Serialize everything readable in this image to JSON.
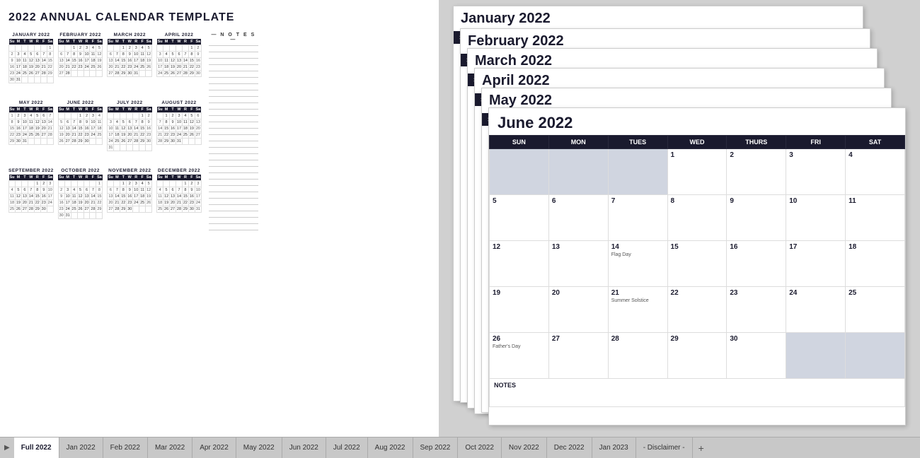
{
  "title": "2022 ANNUAL CALENDAR TEMPLATE",
  "colors": {
    "header_dark": "#1a1a2e",
    "shaded_cell": "#d0d5e0",
    "empty_cell": "#e8eaf0"
  },
  "mini_months": [
    {
      "name": "JANUARY 2022",
      "days_header": [
        "Su",
        "M",
        "T",
        "W",
        "R",
        "F",
        "Sa"
      ],
      "weeks": [
        [
          "",
          "",
          "",
          "",
          "",
          "",
          "1"
        ],
        [
          "2",
          "3",
          "4",
          "5",
          "6",
          "7",
          "8"
        ],
        [
          "9",
          "10",
          "11",
          "12",
          "13",
          "14",
          "15"
        ],
        [
          "16",
          "17",
          "18",
          "19",
          "20",
          "21",
          "22"
        ],
        [
          "23",
          "24",
          "25",
          "26",
          "27",
          "28",
          "29"
        ],
        [
          "30",
          "31",
          "",
          "",
          "",
          "",
          ""
        ]
      ]
    },
    {
      "name": "FEBRUARY 2022",
      "days_header": [
        "Su",
        "M",
        "T",
        "W",
        "R",
        "F",
        "Sa"
      ],
      "weeks": [
        [
          "",
          "",
          "1",
          "2",
          "3",
          "4",
          "5"
        ],
        [
          "6",
          "7",
          "8",
          "9",
          "10",
          "11",
          "12"
        ],
        [
          "13",
          "14",
          "15",
          "16",
          "17",
          "18",
          "19"
        ],
        [
          "20",
          "21",
          "22",
          "23",
          "24",
          "25",
          "26"
        ],
        [
          "27",
          "28",
          "",
          "",
          "",
          "",
          ""
        ]
      ]
    },
    {
      "name": "MARCH 2022",
      "days_header": [
        "Su",
        "M",
        "T",
        "W",
        "R",
        "F",
        "Sa"
      ],
      "weeks": [
        [
          "",
          "",
          "1",
          "2",
          "3",
          "4",
          "5"
        ],
        [
          "6",
          "7",
          "8",
          "9",
          "10",
          "11",
          "12"
        ],
        [
          "13",
          "14",
          "15",
          "16",
          "17",
          "18",
          "19"
        ],
        [
          "20",
          "21",
          "22",
          "23",
          "24",
          "25",
          "26"
        ],
        [
          "27",
          "28",
          "29",
          "30",
          "31",
          "",
          ""
        ]
      ]
    },
    {
      "name": "APRIL 2022",
      "days_header": [
        "Su",
        "M",
        "T",
        "W",
        "R",
        "F",
        "Sa"
      ],
      "weeks": [
        [
          "",
          "",
          "",
          "",
          "",
          "1",
          "2"
        ],
        [
          "3",
          "4",
          "5",
          "6",
          "7",
          "8",
          "9"
        ],
        [
          "10",
          "11",
          "12",
          "13",
          "14",
          "15",
          "16"
        ],
        [
          "17",
          "18",
          "19",
          "20",
          "21",
          "22",
          "23"
        ],
        [
          "24",
          "25",
          "26",
          "27",
          "28",
          "29",
          "30"
        ]
      ]
    },
    {
      "name": "MAY 2022",
      "days_header": [
        "Su",
        "M",
        "T",
        "W",
        "R",
        "F",
        "Sa"
      ],
      "weeks": [
        [
          "1",
          "2",
          "3",
          "4",
          "5",
          "6",
          "7"
        ],
        [
          "8",
          "9",
          "10",
          "11",
          "12",
          "13",
          "14"
        ],
        [
          "15",
          "16",
          "17",
          "18",
          "19",
          "20",
          "21"
        ],
        [
          "22",
          "23",
          "24",
          "25",
          "26",
          "27",
          "28"
        ],
        [
          "29",
          "30",
          "31",
          "",
          "",
          "",
          ""
        ]
      ]
    },
    {
      "name": "JUNE 2022",
      "days_header": [
        "Su",
        "M",
        "T",
        "W",
        "R",
        "F",
        "Sa"
      ],
      "weeks": [
        [
          "",
          "",
          "",
          "1",
          "2",
          "3",
          "4"
        ],
        [
          "5",
          "6",
          "7",
          "8",
          "9",
          "10",
          "11"
        ],
        [
          "12",
          "13",
          "14",
          "15",
          "16",
          "17",
          "18"
        ],
        [
          "19",
          "20",
          "21",
          "22",
          "23",
          "24",
          "25"
        ],
        [
          "26",
          "27",
          "28",
          "29",
          "30",
          "",
          ""
        ]
      ]
    },
    {
      "name": "JULY 2022",
      "days_header": [
        "Su",
        "M",
        "T",
        "W",
        "R",
        "F",
        "Sa"
      ],
      "weeks": [
        [
          "",
          "",
          "",
          "",
          "",
          "1",
          "2"
        ],
        [
          "3",
          "4",
          "5",
          "6",
          "7",
          "8",
          "9"
        ],
        [
          "10",
          "11",
          "12",
          "13",
          "14",
          "15",
          "16"
        ],
        [
          "17",
          "18",
          "19",
          "20",
          "21",
          "22",
          "23"
        ],
        [
          "24",
          "25",
          "26",
          "27",
          "28",
          "29",
          "30"
        ],
        [
          "31",
          "",
          "",
          "",
          "",
          "",
          ""
        ]
      ]
    },
    {
      "name": "AUGUST 2022",
      "days_header": [
        "Su",
        "M",
        "T",
        "W",
        "R",
        "F",
        "Sa"
      ],
      "weeks": [
        [
          "",
          "1",
          "2",
          "3",
          "4",
          "5",
          "6"
        ],
        [
          "7",
          "8",
          "9",
          "10",
          "11",
          "12",
          "13"
        ],
        [
          "14",
          "15",
          "16",
          "17",
          "18",
          "19",
          "20"
        ],
        [
          "21",
          "22",
          "23",
          "24",
          "25",
          "26",
          "27"
        ],
        [
          "28",
          "29",
          "30",
          "31",
          "",
          "",
          ""
        ]
      ]
    },
    {
      "name": "SEPTEMBER 2022",
      "days_header": [
        "Su",
        "M",
        "T",
        "W",
        "R",
        "F",
        "Sa"
      ],
      "weeks": [
        [
          "",
          "",
          "",
          "",
          "1",
          "2",
          "3"
        ],
        [
          "4",
          "5",
          "6",
          "7",
          "8",
          "9",
          "10"
        ],
        [
          "11",
          "12",
          "13",
          "14",
          "15",
          "16",
          "17"
        ],
        [
          "18",
          "19",
          "20",
          "21",
          "22",
          "23",
          "24"
        ],
        [
          "25",
          "26",
          "27",
          "28",
          "29",
          "30",
          ""
        ]
      ]
    },
    {
      "name": "OCTOBER 2022",
      "days_header": [
        "Su",
        "M",
        "T",
        "W",
        "R",
        "F",
        "Sa"
      ],
      "weeks": [
        [
          "",
          "",
          "",
          "",
          "",
          "",
          "1"
        ],
        [
          "2",
          "3",
          "4",
          "5",
          "6",
          "7",
          "8"
        ],
        [
          "9",
          "10",
          "11",
          "12",
          "13",
          "14",
          "15"
        ],
        [
          "16",
          "17",
          "18",
          "19",
          "20",
          "21",
          "22"
        ],
        [
          "23",
          "24",
          "25",
          "26",
          "27",
          "28",
          "29"
        ],
        [
          "30",
          "31",
          "",
          "",
          "",
          "",
          ""
        ]
      ]
    },
    {
      "name": "NOVEMBER 2022",
      "days_header": [
        "Su",
        "M",
        "T",
        "W",
        "R",
        "F",
        "Sa"
      ],
      "weeks": [
        [
          "",
          "",
          "1",
          "2",
          "3",
          "4",
          "5"
        ],
        [
          "6",
          "7",
          "8",
          "9",
          "10",
          "11",
          "12"
        ],
        [
          "13",
          "14",
          "15",
          "16",
          "17",
          "18",
          "19"
        ],
        [
          "20",
          "21",
          "22",
          "23",
          "24",
          "25",
          "26"
        ],
        [
          "27",
          "28",
          "29",
          "30",
          "",
          "",
          ""
        ]
      ]
    },
    {
      "name": "DECEMBER 2022",
      "days_header": [
        "Su",
        "M",
        "T",
        "W",
        "R",
        "F",
        "Sa"
      ],
      "weeks": [
        [
          "",
          "",
          "",
          "",
          "1",
          "2",
          "3"
        ],
        [
          "4",
          "5",
          "6",
          "7",
          "8",
          "9",
          "10"
        ],
        [
          "11",
          "12",
          "13",
          "14",
          "15",
          "16",
          "17"
        ],
        [
          "18",
          "19",
          "20",
          "21",
          "22",
          "23",
          "24"
        ],
        [
          "25",
          "26",
          "27",
          "28",
          "29",
          "30",
          "31"
        ]
      ]
    }
  ],
  "notes_label": "— N O T E S —",
  "june_full": {
    "title": "June 2022",
    "headers": [
      "SUN",
      "MON",
      "TUES",
      "WED",
      "THURS",
      "FRI",
      "SAT"
    ],
    "weeks": [
      [
        {
          "d": "",
          "shaded": true
        },
        {
          "d": "",
          "shaded": true
        },
        {
          "d": "",
          "shaded": true
        },
        {
          "d": "1",
          "shaded": false
        },
        {
          "d": "2",
          "shaded": false
        },
        {
          "d": "3",
          "shaded": false
        },
        {
          "d": "4",
          "shaded": false
        }
      ],
      [
        {
          "d": "5",
          "shaded": false
        },
        {
          "d": "6",
          "shaded": false
        },
        {
          "d": "7",
          "shaded": false
        },
        {
          "d": "8",
          "shaded": false
        },
        {
          "d": "9",
          "shaded": false
        },
        {
          "d": "10",
          "shaded": false
        },
        {
          "d": "11",
          "shaded": false
        }
      ],
      [
        {
          "d": "12",
          "shaded": false
        },
        {
          "d": "13",
          "shaded": false
        },
        {
          "d": "14",
          "shaded": false,
          "note": "Flag Day"
        },
        {
          "d": "15",
          "shaded": false
        },
        {
          "d": "16",
          "shaded": false
        },
        {
          "d": "17",
          "shaded": false
        },
        {
          "d": "18",
          "shaded": false
        }
      ],
      [
        {
          "d": "19",
          "shaded": false
        },
        {
          "d": "20",
          "shaded": false
        },
        {
          "d": "21",
          "shaded": false,
          "note": "Summer Solstice"
        },
        {
          "d": "22",
          "shaded": false
        },
        {
          "d": "23",
          "shaded": false
        },
        {
          "d": "24",
          "shaded": false
        },
        {
          "d": "25",
          "shaded": false
        }
      ],
      [
        {
          "d": "26",
          "shaded": false,
          "note": "Father's Day"
        },
        {
          "d": "27",
          "shaded": false
        },
        {
          "d": "28",
          "shaded": false
        },
        {
          "d": "29",
          "shaded": false
        },
        {
          "d": "30",
          "shaded": false
        },
        {
          "d": "",
          "shaded": true
        },
        {
          "d": "",
          "shaded": true
        }
      ]
    ],
    "notes_label": "NOTES"
  },
  "stack_months": [
    "January 2022",
    "February 2022",
    "March 2022",
    "April 2022",
    "May 2022"
  ],
  "tabs": {
    "play": "▶",
    "items": [
      "Full 2022",
      "Jan 2022",
      "Feb 2022",
      "Mar 2022",
      "Apr 2022",
      "May 2022",
      "Jun 2022",
      "Jul 2022",
      "Aug 2022",
      "Sep 2022",
      "Oct 2022",
      "Nov 2022",
      "Dec 2022",
      "Jan 2023",
      "- Disclaimer -"
    ],
    "active": "Full 2022",
    "add": "+"
  }
}
